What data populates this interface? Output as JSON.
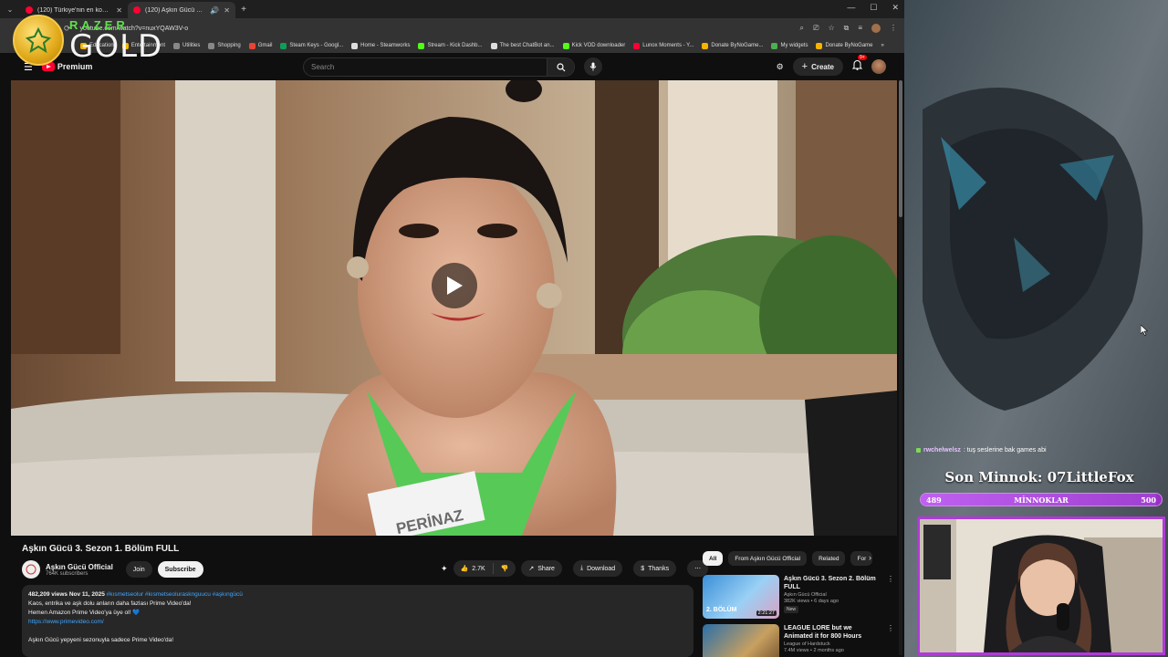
{
  "browser": {
    "tabs": [
      {
        "title": "(120) Türkiye'nin en komik film",
        "active": false
      },
      {
        "title": "(120) Aşkın Gücü 3. Sezon",
        "active": true
      }
    ],
    "url": "youtube.com/watch?v=nuxYQAW3V-o",
    "bookmarks": [
      {
        "label": "Education",
        "color": "#f4b400"
      },
      {
        "label": "Entertainment",
        "color": "#f4b400"
      },
      {
        "label": "Utilities",
        "color": "#888888"
      },
      {
        "label": "Shopping",
        "color": "#888888"
      },
      {
        "label": "Gmail",
        "color": "#ea4335"
      },
      {
        "label": "Steam Keys - Googl...",
        "color": "#0f9d58"
      },
      {
        "label": "Home - Steamworks",
        "color": "#ffffff"
      },
      {
        "label": "Stream - Kick Dashb...",
        "color": "#53fc18"
      },
      {
        "label": "The best ChatBot an...",
        "color": "#ffffff"
      },
      {
        "label": "Kick VOD downloader",
        "color": "#53fc18"
      },
      {
        "label": "Lunox Moments - Y...",
        "color": "#ff0033"
      },
      {
        "label": "Donate ByNoGame...",
        "color": "#f4b400"
      },
      {
        "label": "My widgets",
        "color": "#4caf50"
      },
      {
        "label": "Donate ByNoGame",
        "color": "#f4b400"
      }
    ]
  },
  "razer": {
    "brand": "RAZER",
    "tier": "GOLD"
  },
  "youtube": {
    "logo_label": "Premium",
    "search_placeholder": "Search",
    "create_label": "Create",
    "notif_count": "9+"
  },
  "video": {
    "title": "Aşkın Gücü 3. Sezon 1. Bölüm FULL",
    "nametag": "PERİNAZ",
    "channel": "Aşkın Gücü Official",
    "subscribers": "764K subscribers",
    "join_label": "Join",
    "subscribe_label": "Subscribe",
    "likes": "2.7K",
    "share_label": "Share",
    "download_label": "Download",
    "thanks_label": "Thanks"
  },
  "description": {
    "stats": "482,209 views  Nov 11, 2025",
    "hashtags": "#kısmetseolur #kısmetseolurasknguucu #aşkıngücü",
    "line1": "Kaos, entrika ve aşk dolu anların daha fazlası Prime Video'da!",
    "line2": "Hemen Amazon Prime Video'ya üye ol! 💙",
    "link": "https://www.primevideo.com/",
    "line3": "Aşkın Gücü yepyeni sezonuyla sadece Prime Video'da!"
  },
  "suggestions": {
    "chips": [
      "All",
      "From Aşkın Gücü Official",
      "Related",
      "For"
    ],
    "items": [
      {
        "title": "Aşkın Gücü 3. Sezon 2. Bölüm FULL",
        "channel": "Aşkın Gücü Official",
        "meta": "382K views • 6 days ago",
        "badge": "New",
        "duration": "2:21:27",
        "thumb_text": "2. BÖLÜM"
      },
      {
        "title": "LEAGUE LORE but we Animated it for 800 Hours",
        "channel": "League of Hardstuck",
        "meta": "7.4M views • 2 months ago",
        "badge": "",
        "duration": "",
        "thumb_text": ""
      }
    ]
  },
  "overlay": {
    "chat_user": "rwchelwelsz",
    "chat_message": ": tuş seslerine bak games abi",
    "last_label": "Son Minnok: 07LittleFox",
    "goal_label": "MİNNOKLAR",
    "goal_current": 489,
    "goal_target": 500
  },
  "colors": {
    "accent": "#ff0033",
    "overlay_purple": "#9b2fc4",
    "link_blue": "#3ea6ff"
  }
}
